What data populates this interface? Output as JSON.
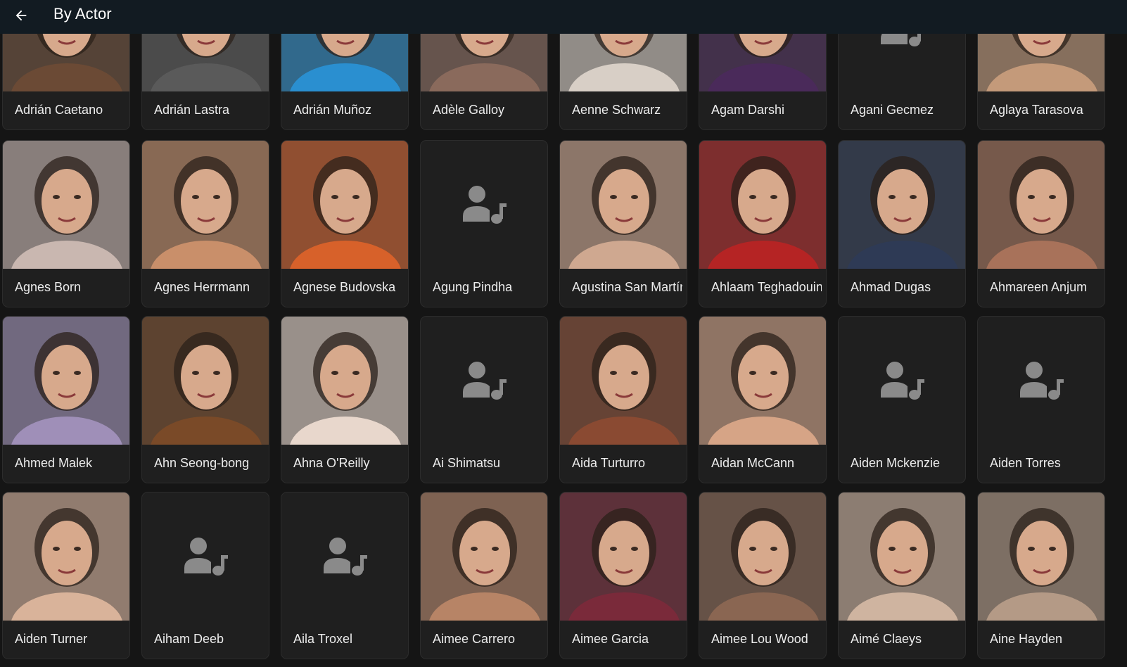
{
  "header": {
    "title": "By Actor",
    "back_icon": "arrow-left-icon"
  },
  "colors": {
    "background": "#151515",
    "card": "#1f1f1f",
    "topbar": "#121b22",
    "placeholder_icon": "#8a8a8a"
  },
  "actors": [
    {
      "name": "Adrián Caetano",
      "photo": true,
      "tone": "#6b4a35"
    },
    {
      "name": "Adrián Lastra",
      "photo": true,
      "tone": "#5a5a5a"
    },
    {
      "name": "Adrián Muñoz",
      "photo": true,
      "tone": "#2a8fd0"
    },
    {
      "name": "Adèle Galloy",
      "photo": true,
      "tone": "#8a6a5c"
    },
    {
      "name": "Aenne Schwarz",
      "photo": true,
      "tone": "#d8cfc6"
    },
    {
      "name": "Agam Darshi",
      "photo": true,
      "tone": "#4a2a5a"
    },
    {
      "name": "Agani Gecmez",
      "photo": false
    },
    {
      "name": "Aglaya Tarasova",
      "photo": true,
      "tone": "#c49a7a"
    },
    {
      "name": "Agnes Born",
      "photo": true,
      "tone": "#c9b7b0"
    },
    {
      "name": "Agnes Herrmann",
      "photo": true,
      "tone": "#c98f6a"
    },
    {
      "name": "Agnese Budovska",
      "photo": true,
      "tone": "#d7612a"
    },
    {
      "name": "Agung Pindha",
      "photo": false
    },
    {
      "name": "Agustina San Martín",
      "photo": true,
      "tone": "#cfa890"
    },
    {
      "name": "Ahlaam Teghadouini",
      "photo": true,
      "tone": "#b52424"
    },
    {
      "name": "Ahmad Dugas",
      "photo": true,
      "tone": "#2e3a55"
    },
    {
      "name": "Ahmareen Anjum",
      "photo": true,
      "tone": "#a8725a"
    },
    {
      "name": "Ahmed Malek",
      "photo": true,
      "tone": "#9f8fb8"
    },
    {
      "name": "Ahn Seong-bong",
      "photo": true,
      "tone": "#7a4a28"
    },
    {
      "name": "Ahna O'Reilly",
      "photo": true,
      "tone": "#e8d7cc"
    },
    {
      "name": "Ai Shimatsu",
      "photo": false
    },
    {
      "name": "Aida Turturro",
      "photo": true,
      "tone": "#8a4a32"
    },
    {
      "name": "Aidan McCann",
      "photo": true,
      "tone": "#d6a486"
    },
    {
      "name": "Aiden Mckenzie",
      "photo": false
    },
    {
      "name": "Aiden Torres",
      "photo": false
    },
    {
      "name": "Aiden Turner",
      "photo": true,
      "tone": "#d9b39a"
    },
    {
      "name": "Aiham Deeb",
      "photo": false
    },
    {
      "name": "Aila Troxel",
      "photo": false
    },
    {
      "name": "Aimee Carrero",
      "photo": true,
      "tone": "#b78466"
    },
    {
      "name": "Aimee Garcia",
      "photo": true,
      "tone": "#7a2a3a"
    },
    {
      "name": "Aimee Lou Wood",
      "photo": true,
      "tone": "#8a6652"
    },
    {
      "name": "Aimé Claeys",
      "photo": true,
      "tone": "#cfb4a0"
    },
    {
      "name": "Aine Hayden",
      "photo": true,
      "tone": "#b49a86"
    }
  ]
}
